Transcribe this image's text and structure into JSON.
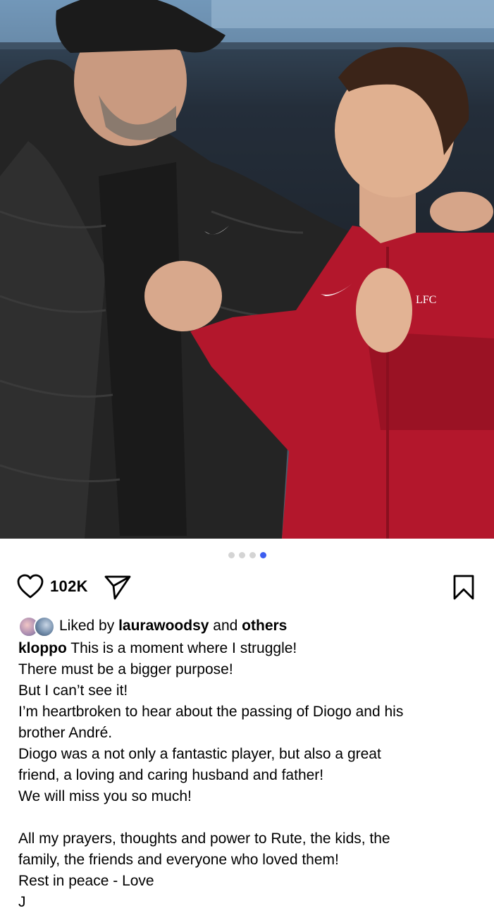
{
  "post": {
    "likes_count": "102K",
    "liked_by_prefix": "Liked by",
    "liked_by_user": "laurawoodsy",
    "liked_by_and": "and",
    "liked_by_others": "others",
    "author": "kloppo",
    "caption_first_line": "This is a moment where I struggle!",
    "caption_lines": [
      "There must be a bigger purpose!",
      "But I can’t see it!",
      "I’m heartbroken to hear about the passing of Diogo and his",
      "brother André.",
      "Diogo was a not only a fantastic player, but also a great",
      "friend, a loving and caring husband and father!",
      "We will miss you so much!",
      "",
      "All my prayers, thoughts and power to Rute, the kids, the",
      "family, the friends and everyone who loved them!",
      "Rest in peace - Love",
      "J"
    ]
  },
  "photo_text": {
    "crest": "LFC"
  },
  "carousel": {
    "total": 4,
    "active_index": 4
  },
  "colors": {
    "accent_dot": "#3d5ef0",
    "kit_red": "#b3172c",
    "jacket": "#232323"
  },
  "icons": {
    "like": "heart-outline-icon",
    "share": "paper-plane-icon",
    "save": "bookmark-icon"
  }
}
